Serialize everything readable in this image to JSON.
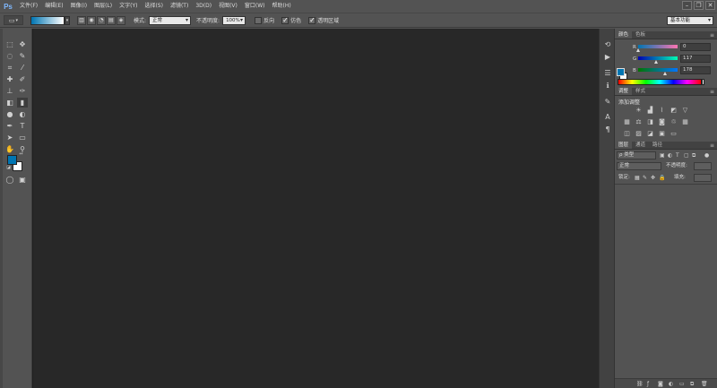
{
  "app": {
    "logo": "Ps"
  },
  "menu": [
    "文件(F)",
    "编辑(E)",
    "图像(I)",
    "图层(L)",
    "文字(Y)",
    "选择(S)",
    "滤镜(T)",
    "3D(D)",
    "视图(V)",
    "窗口(W)",
    "帮助(H)"
  ],
  "options": {
    "mode_label": "模式:",
    "mode_value": "正常",
    "opacity_label": "不透明度:",
    "opacity_value": "100%",
    "reverse_label": "反向",
    "dither_label": "仿色",
    "transparency_label": "透明区域",
    "workspace": "基本功能"
  },
  "panels": {
    "color_tabs": [
      "颜色",
      "色板"
    ],
    "color": {
      "r_label": "R",
      "r_value": "0",
      "g_label": "G",
      "g_value": "117",
      "b_label": "B",
      "b_value": "178",
      "foreground": "#0075b2",
      "background": "#ffffff"
    },
    "adjust_tabs": [
      "调整",
      "样式"
    ],
    "adjust_title": "添加调整",
    "layers_tabs": [
      "图层",
      "通道",
      "路径"
    ],
    "layers": {
      "filter_value": "ρ 类型",
      "blend_value": "正常",
      "opacity_label": "不透明度:",
      "lock_label": "锁定:",
      "fill_label": "填充:"
    }
  }
}
